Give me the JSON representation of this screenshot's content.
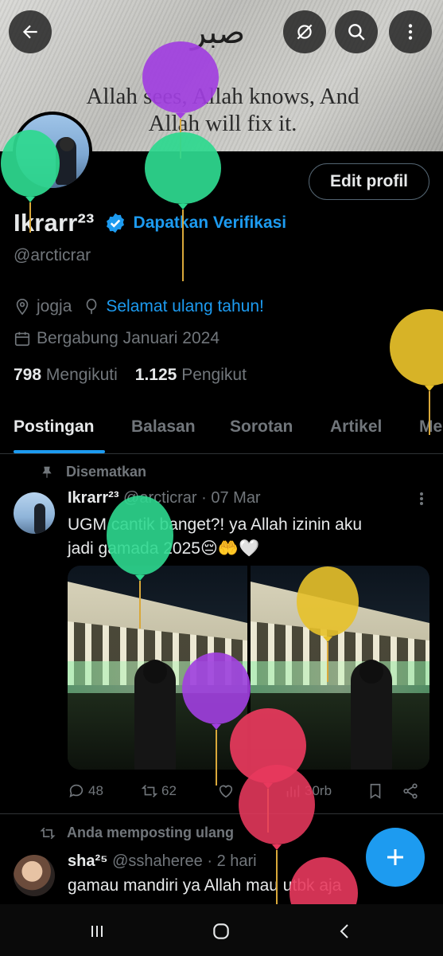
{
  "banner": {
    "arabic_text": "صبر",
    "quote_line1": "Allah sees, Allah knows, And",
    "quote_line2": "Allah will fix it."
  },
  "top_bar": {
    "back_icon": "arrow-left-icon",
    "buttons": [
      "no-sync-icon",
      "search-icon",
      "more-vertical-icon"
    ]
  },
  "profile": {
    "edit_label": "Edit profil",
    "name": "Ikrarr²³",
    "verify_label": "Dapatkan Verifikasi",
    "handle": "@arcticrar",
    "location": "jogja",
    "birthday_text": "Selamat ulang tahun!",
    "joined": "Bergabung Januari 2024",
    "following_count": "798",
    "following_label": "Mengikuti",
    "followers_count": "1.125",
    "followers_label": "Pengikut"
  },
  "tabs": [
    {
      "label": "Postingan",
      "active": true
    },
    {
      "label": "Balasan"
    },
    {
      "label": "Sorotan"
    },
    {
      "label": "Artikel"
    },
    {
      "label": "Me"
    }
  ],
  "pinned_tweet": {
    "pinned_label": "Disematkan",
    "author_name": "Ikrarr²³",
    "author_handle": "@arcticrar · 07 Mar",
    "text_line1": "UGM cantik banget?! ya Allah izinin aku",
    "text_line2": "jadi gamada 2025😔🤲🤍",
    "replies": "48",
    "reposts": "62",
    "likes": "",
    "views": "30rb"
  },
  "repost": {
    "repost_label": "Anda memposting ulang",
    "author_name": "sha²⁵",
    "author_handle": "@sshaheree · 2 hari",
    "text": "gamau mandiri ya Allah mau utbk aja"
  },
  "colors": {
    "accent": "#1d9bf0",
    "text": "#e7e9ea",
    "muted": "#71767b",
    "border": "#2f3336",
    "background": "#000000"
  }
}
